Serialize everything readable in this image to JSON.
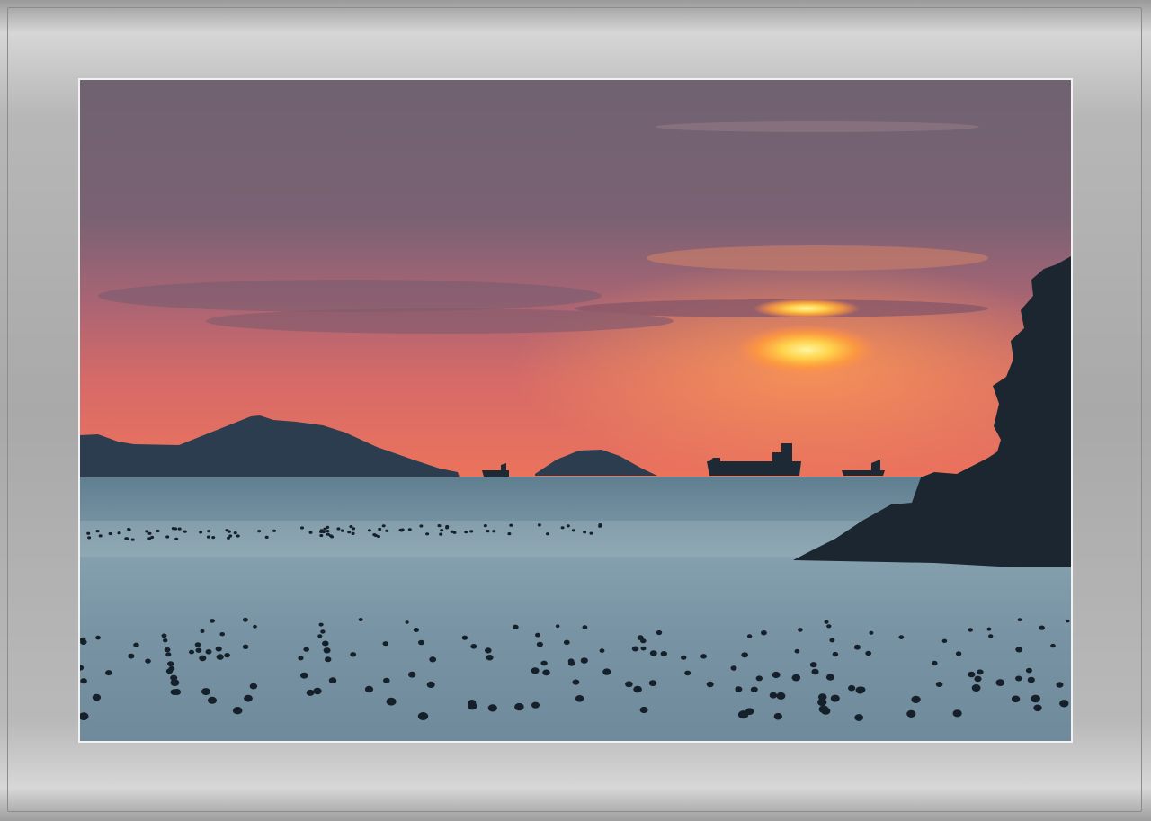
{
  "scene": {
    "subject": "",
    "colors": {
      "sky_top": "#6f6271",
      "sky_mid": "#8a6073",
      "sky_horizon": "#e8705e",
      "sun_core": "#fff27a",
      "sun_glow": "#ffa340",
      "sea": "#7896a5",
      "silhouette": "#1d2a36"
    }
  }
}
